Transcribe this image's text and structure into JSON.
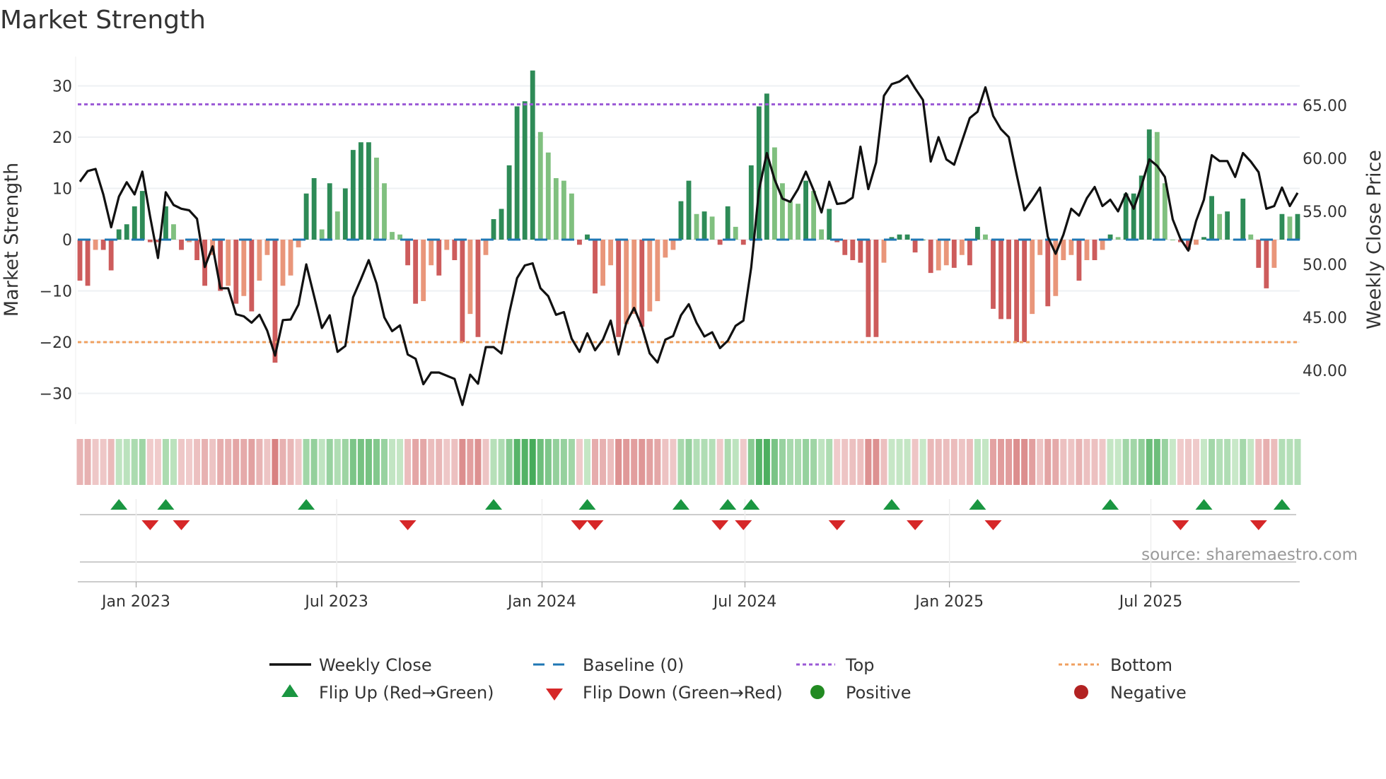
{
  "chart_data": {
    "type": "bar",
    "title": "Market Strength",
    "ylabel": "Market Strength",
    "y2label": "Weekly Close Price",
    "ylim": [
      -36,
      36
    ],
    "y2lim": [
      35,
      68
    ],
    "yticks": [
      30,
      20,
      10,
      0,
      -10,
      -20,
      -30
    ],
    "yticklabels": [
      "30",
      "20",
      "10",
      "0",
      "−10",
      "−20",
      "−30"
    ],
    "y2ticks": [
      65,
      60,
      55,
      50,
      45,
      40
    ],
    "y2ticklabels": [
      "65.00",
      "60.00",
      "55.00",
      "50.00",
      "45.00",
      "40.00"
    ],
    "xticks": [
      {
        "week": 7.2,
        "label": "Jan 2023"
      },
      {
        "week": 32.9,
        "label": "Jul 2023"
      },
      {
        "week": 59.2,
        "label": "Jan 2024"
      },
      {
        "week": 85.2,
        "label": "Jul 2024"
      },
      {
        "week": 111.4,
        "label": "Jan 2025"
      },
      {
        "week": 137.2,
        "label": "Jul 2025"
      }
    ],
    "top_level": 26.4,
    "bottom_level": -20,
    "baseline": 0,
    "strength": [
      -8,
      -9,
      -2,
      -2,
      -6,
      2,
      3,
      6.5,
      9.5,
      -0.5,
      -0.5,
      6.5,
      3,
      -2,
      -0.5,
      -4,
      -9,
      -3,
      -10,
      -9,
      -12.5,
      -11,
      -14,
      -8,
      -3,
      -24,
      -9,
      -7,
      -1.5,
      9,
      12,
      2,
      11,
      5.5,
      10,
      17.5,
      19,
      19,
      16,
      11,
      1.5,
      1,
      -5,
      -12.5,
      -12,
      -5,
      -7,
      -2,
      -4,
      -20,
      -14.5,
      -19,
      -3,
      4,
      6,
      14.5,
      26,
      27,
      33,
      21,
      17,
      12,
      11.5,
      9,
      -1,
      1,
      -10.5,
      -9,
      -5,
      -19,
      -16.5,
      -14.5,
      -17,
      -14,
      -12,
      -3.5,
      -2,
      7.5,
      11.5,
      5,
      5.5,
      4.5,
      -1,
      6.5,
      2.5,
      -1,
      14.5,
      26,
      28.5,
      18,
      11,
      7.5,
      7,
      11.5,
      9.5,
      2,
      6,
      -0.5,
      -3,
      -4,
      -4.5,
      -19,
      -19,
      -4.5,
      0.5,
      1,
      1,
      -2.5,
      0,
      -6.5,
      -6,
      -5,
      -5.5,
      -3,
      -5,
      2.5,
      1,
      -13.5,
      -15.5,
      -15.5,
      -20,
      -20,
      -14.5,
      -3,
      -13,
      -11,
      -4,
      -3,
      -8,
      -4,
      -4,
      -2,
      1,
      0.5,
      9,
      9,
      12.5,
      21.5,
      21,
      11,
      0,
      -0.5,
      -2,
      -1,
      0.5,
      8.5,
      5,
      5.5,
      0,
      8,
      1,
      -5.5,
      -9.5,
      -5.5,
      5,
      4.5,
      5
    ],
    "weekly_close": [
      57.8,
      58.8,
      59,
      56.6,
      53.5,
      56.4,
      57.75,
      56.6,
      58.75,
      54.5,
      50.6,
      56.8,
      55.6,
      55.25,
      55.1,
      54.3,
      49.75,
      51.7,
      47.75,
      47.75,
      45.3,
      45.1,
      44.5,
      45.25,
      43.75,
      41.4,
      44.75,
      44.8,
      46.2,
      50,
      47,
      44,
      45.2,
      41.75,
      42.3,
      46.9,
      48.6,
      50.4,
      48.2,
      45,
      43.7,
      44.25,
      41.5,
      41.1,
      38.7,
      39.8,
      39.8,
      39.5,
      39.2,
      36.75,
      39.6,
      38.75,
      42.2,
      42.2,
      41.6,
      45.4,
      48.7,
      49.9,
      50.1,
      47.75,
      47,
      45.25,
      45.5,
      43,
      41.75,
      43.5,
      41.9,
      42.9,
      44.7,
      41.5,
      44.5,
      45.9,
      44.1,
      41.6,
      40.75,
      42.9,
      43.25,
      45.2,
      46.25,
      44.5,
      43.2,
      43.6,
      42.1,
      42.8,
      44.2,
      44.7,
      49.7,
      57,
      60.5,
      58,
      56.2,
      55.9,
      57.1,
      58.75,
      57,
      54.9,
      57.8,
      55.7,
      55.8,
      56.3,
      61.1,
      57.1,
      59.6,
      65.9,
      67,
      67.25,
      67.8,
      66.6,
      65.5,
      59.7,
      62,
      59.9,
      59.4,
      61.6,
      63.8,
      64.4,
      66.7,
      64,
      62.75,
      62,
      58.5,
      55.1,
      56.1,
      57.25,
      52.6,
      51,
      52.8,
      55.25,
      54.6,
      56.25,
      57.3,
      55.5,
      56.1,
      55,
      56.7,
      55.25,
      57.4,
      59.9,
      59.3,
      58.25,
      54.25,
      52.4,
      51.3,
      54.1,
      56.1,
      60.3,
      59.75,
      59.75,
      58.25,
      60.5,
      59.7,
      58.7,
      55.25,
      55.5,
      57.25,
      55.5,
      56.75
    ],
    "flip_up_weeks": [
      5,
      11,
      29,
      53,
      65,
      77,
      83,
      86,
      104,
      115,
      132,
      144,
      154
    ],
    "flip_down_weeks": [
      9,
      13,
      42,
      64,
      66,
      82,
      85,
      97,
      107,
      117,
      141,
      151
    ],
    "legend": {
      "weekly_close": "Weekly Close",
      "baseline": "Baseline (0)",
      "top": "Top",
      "bottom": "Bottom",
      "flip_up": "Flip Up (Red→Green)",
      "flip_down": "Flip Down (Green→Red)",
      "positive": "Positive",
      "negative": "Negative"
    },
    "legend_placement": "bottom",
    "source": "source: sharemaestro.com"
  },
  "colors": {
    "pos_strong": "#2e8b57",
    "pos_weak": "#80c07f",
    "neg_strong": "#cd5c5c",
    "neg_weak": "#e9967a",
    "line": "#111111",
    "baseline": "#1f77b4",
    "top": "#9b59d6",
    "bottom": "#f0a060",
    "flip_up": "#1a9641",
    "flip_down": "#d62728",
    "positive": "#228b22",
    "negative": "#b22222"
  }
}
